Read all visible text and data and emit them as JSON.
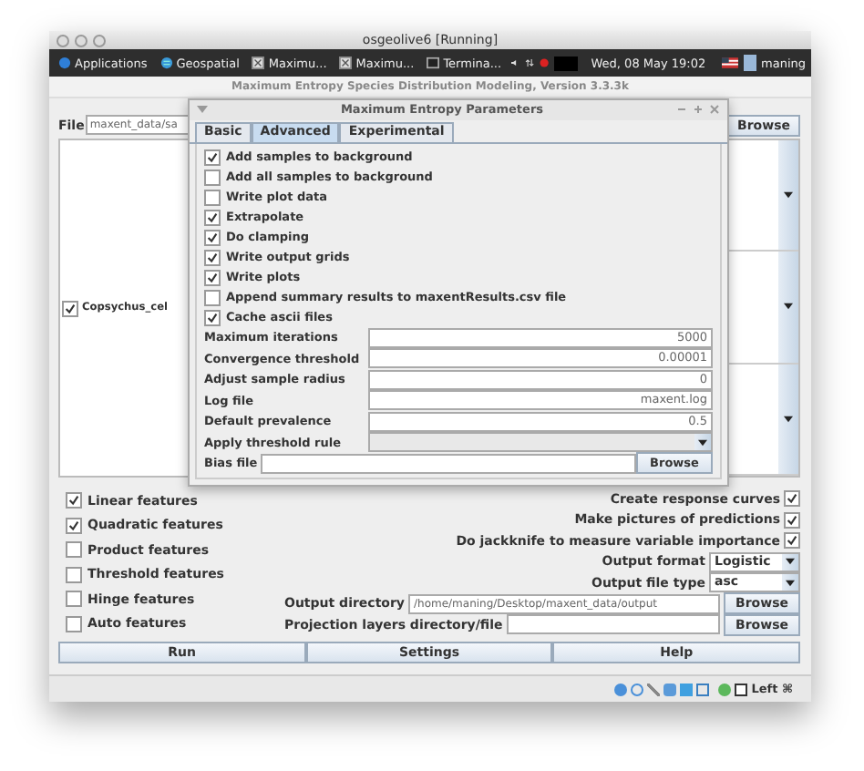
{
  "host_window": {
    "title": "osgeolive6 [Running]"
  },
  "taskbar": {
    "items": [
      {
        "label": "Applications",
        "kind": "menu"
      },
      {
        "label": "Geospatial",
        "kind": "menu"
      },
      {
        "label": "Maximu...",
        "kind": "window"
      },
      {
        "label": "Maximu...",
        "kind": "window"
      },
      {
        "label": "Termina...",
        "kind": "terminal"
      }
    ],
    "clock": "Wed, 08 May 19:02",
    "user": "maning"
  },
  "app_window": {
    "title": "Maximum Entropy Species Distribution Modeling, Version 3.3.3k"
  },
  "file": {
    "label": "File",
    "value": "maxent_data/sa",
    "button": "Browse"
  },
  "samples": [
    {
      "label": "Copsychus_cel",
      "checked": true
    }
  ],
  "features": [
    {
      "label": "Linear features",
      "checked": true
    },
    {
      "label": "Quadratic features",
      "checked": true
    },
    {
      "label": "Product features",
      "checked": false
    },
    {
      "label": "Threshold features",
      "checked": false
    },
    {
      "label": "Hinge features",
      "checked": false
    },
    {
      "label": "Auto features",
      "checked": false
    }
  ],
  "options": [
    {
      "label": "Create response curves",
      "checked": true
    },
    {
      "label": "Make pictures of predictions",
      "checked": true
    },
    {
      "label": "Do jackknife to measure variable importance",
      "checked": true
    }
  ],
  "output_settings": [
    {
      "label": "Output format",
      "value": "Logistic",
      "kind": "dropdown"
    },
    {
      "label": "Output file type",
      "value": "asc",
      "kind": "dropdown"
    },
    {
      "label": "Output directory",
      "value": "/home/maning/Desktop/maxent_data/output",
      "button": "Browse",
      "kind": "file"
    },
    {
      "label": "Projection layers directory/file",
      "button": "Browse",
      "kind": "file"
    }
  ],
  "actions": [
    "Run",
    "Settings",
    "Help"
  ],
  "status_bar": {
    "host_key": "Left ⌘"
  },
  "dialog": {
    "title": "Maximum Entropy Parameters",
    "tabs": [
      {
        "label": "Basic",
        "selected": false
      },
      {
        "label": "Advanced",
        "selected": true
      },
      {
        "label": "Experimental",
        "selected": false
      }
    ],
    "checkboxes": [
      {
        "label": "Add samples to background",
        "checked": true
      },
      {
        "label": "Add all samples to background",
        "checked": false
      },
      {
        "label": "Write plot data",
        "checked": false
      },
      {
        "label": "Extrapolate",
        "checked": true
      },
      {
        "label": "Do clamping",
        "checked": true
      },
      {
        "label": "Write output grids",
        "checked": true
      },
      {
        "label": "Write plots",
        "checked": true
      },
      {
        "label": "Append summary results to maxentResults.csv file",
        "checked": false
      },
      {
        "label": "Cache ascii files",
        "checked": true
      }
    ],
    "fields": [
      {
        "label": "Maximum iterations",
        "value": "5000",
        "kind": "text"
      },
      {
        "label": "Convergence threshold",
        "value": "0.00001",
        "kind": "text"
      },
      {
        "label": "Adjust sample radius",
        "value": "0",
        "kind": "text"
      },
      {
        "label": "Log file",
        "value": "maxent.log",
        "kind": "text"
      },
      {
        "label": "Default prevalence",
        "value": "0.5",
        "kind": "text"
      },
      {
        "label": "Apply threshold rule",
        "kind": "dropdown"
      },
      {
        "label": "Bias file",
        "button": "Browse",
        "kind": "file"
      }
    ]
  }
}
